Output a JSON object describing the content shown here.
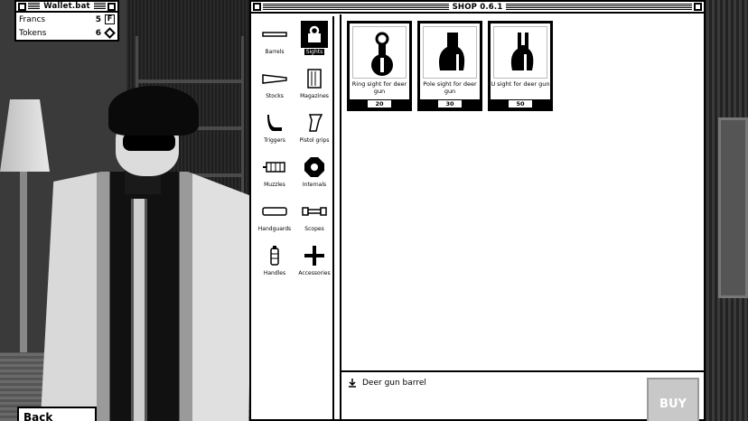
{
  "wallet": {
    "title": "Wallet.bat",
    "rows": [
      {
        "label": "Francs",
        "value": "5",
        "icon_text": "F"
      },
      {
        "label": "Tokens",
        "value": "6"
      }
    ]
  },
  "shop": {
    "title": "SHOP 0.6.1",
    "categories": [
      {
        "label": "Barrels"
      },
      {
        "label": "Sights"
      },
      {
        "label": "Stocks"
      },
      {
        "label": "Magazines"
      },
      {
        "label": "Triggers"
      },
      {
        "label": "Pistol grips"
      },
      {
        "label": "Muzzles"
      },
      {
        "label": "Internals"
      },
      {
        "label": "Handguards"
      },
      {
        "label": "Scopes"
      },
      {
        "label": "Handles"
      },
      {
        "label": "Accessories"
      }
    ],
    "active_category": "Sights",
    "items": [
      {
        "name": "Ring sight for deer gun",
        "price": "20"
      },
      {
        "name": "Pole sight for deer gun",
        "price": "30"
      },
      {
        "name": "U sight for deer gun",
        "price": "50"
      }
    ],
    "detail": {
      "text": "Deer gun barrel"
    },
    "buy_label": "BUY"
  },
  "back_label": "Back"
}
